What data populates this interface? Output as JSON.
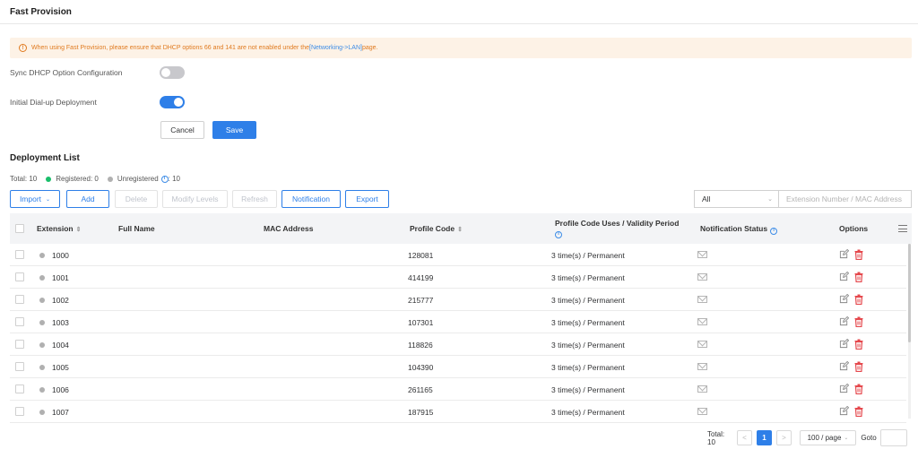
{
  "page": {
    "title": "Fast Provision"
  },
  "notice": {
    "text_before": "When using Fast Provision, please ensure that DHCP options 66 and 141 are not enabled under the ",
    "link": "[Networking->LAN]",
    "text_after": " page."
  },
  "form": {
    "sync_dhcp_label": "Sync DHCP Option Configuration",
    "sync_dhcp_enabled": false,
    "initial_dialup_label": "Initial Dial-up Deployment",
    "initial_dialup_enabled": true,
    "cancel_label": "Cancel",
    "save_label": "Save"
  },
  "deployment": {
    "title": "Deployment List",
    "total_text": "Total: 10",
    "registered_text": "Registered: 0",
    "unregistered_text": "Unregistered",
    "unregistered_count": ": 10"
  },
  "toolbar": {
    "import_label": "Import",
    "add_label": "Add",
    "delete_label": "Delete",
    "modify_levels_label": "Modify Levels",
    "refresh_label": "Refresh",
    "notification_label": "Notification",
    "export_label": "Export"
  },
  "filter": {
    "selected": "All",
    "search_placeholder": "Extension Number / MAC Address"
  },
  "table": {
    "columns": {
      "extension": "Extension",
      "full_name": "Full Name",
      "mac_address": "MAC Address",
      "profile_code": "Profile Code",
      "uses_validity": "Profile Code Uses / Validity Period",
      "notification_status": "Notification Status",
      "options": "Options"
    },
    "rows": [
      {
        "extension": "1000",
        "full_name": "",
        "mac": "",
        "profile_code": "128081",
        "uses": "3 time(s) / Permanent"
      },
      {
        "extension": "1001",
        "full_name": "",
        "mac": "",
        "profile_code": "414199",
        "uses": "3 time(s) / Permanent"
      },
      {
        "extension": "1002",
        "full_name": "",
        "mac": "",
        "profile_code": "215777",
        "uses": "3 time(s) / Permanent"
      },
      {
        "extension": "1003",
        "full_name": "",
        "mac": "",
        "profile_code": "107301",
        "uses": "3 time(s) / Permanent"
      },
      {
        "extension": "1004",
        "full_name": "",
        "mac": "",
        "profile_code": "118826",
        "uses": "3 time(s) / Permanent"
      },
      {
        "extension": "1005",
        "full_name": "",
        "mac": "",
        "profile_code": "104390",
        "uses": "3 time(s) / Permanent"
      },
      {
        "extension": "1006",
        "full_name": "",
        "mac": "",
        "profile_code": "261165",
        "uses": "3 time(s) / Permanent"
      },
      {
        "extension": "1007",
        "full_name": "",
        "mac": "",
        "profile_code": "187915",
        "uses": "3 time(s) / Permanent"
      }
    ]
  },
  "pagination": {
    "total_text": "Total: 10",
    "prev": "<",
    "current_page": "1",
    "next": ">",
    "page_size": "100 / page",
    "goto_label": "Goto"
  },
  "colors": {
    "primary": "#2e7fe8",
    "warning": "#e07a1f",
    "notice_bg": "#fdf2e6",
    "registered": "#19be6b",
    "unregistered": "#b0b0b0",
    "delete": "#e5484d"
  }
}
